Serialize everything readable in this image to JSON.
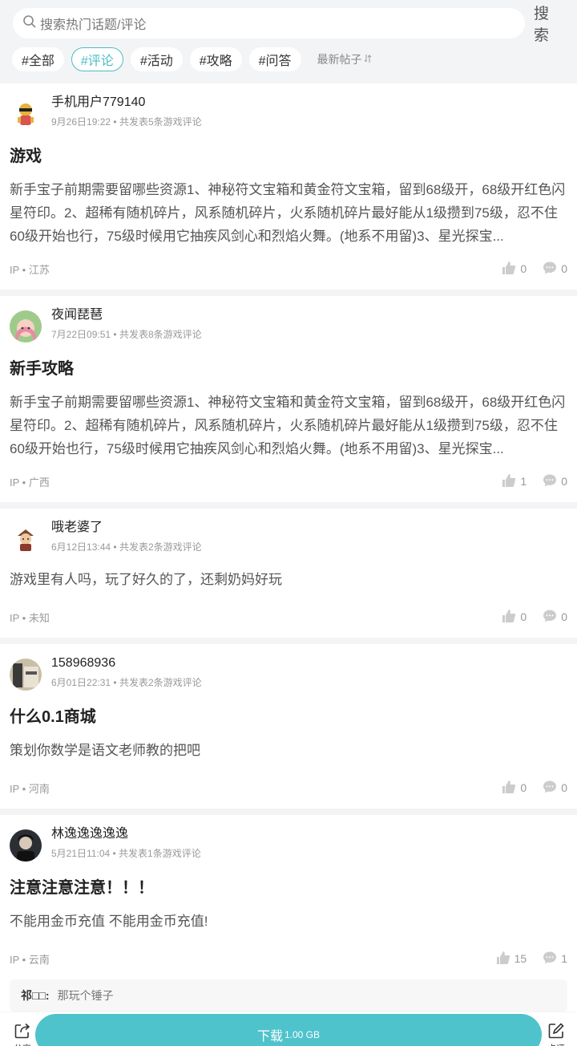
{
  "search": {
    "placeholder": "搜索热门话题/评论",
    "button": "搜索"
  },
  "tags": [
    "#全部",
    "#评论",
    "#活动",
    "#攻略",
    "#问答"
  ],
  "active_tag": "#评论",
  "sort_label": "最新帖子",
  "posts": [
    {
      "user": "手机用户779140",
      "date": "9月26日19:22",
      "meta": "共发表5条游戏评论",
      "title": "游戏",
      "body": "新手宝子前期需要留哪些资源1、神秘符文宝箱和黄金符文宝箱，留到68级开，68级开红色闪星符印。2、超稀有随机碎片，风系随机碎片，火系随机碎片最好能从1级攒到75级，忍不住60级开始也行，75级时候用它抽疾风剑心和烈焰火舞。(地系不用留)3、星光探宝...",
      "ip": "IP • 江苏",
      "likes": "0",
      "comments": "0"
    },
    {
      "user": "夜闻琵琶",
      "date": "7月22日09:51",
      "meta": "共发表8条游戏评论",
      "title": "新手攻略",
      "body": "新手宝子前期需要留哪些资源1、神秘符文宝箱和黄金符文宝箱，留到68级开，68级开红色闪星符印。2、超稀有随机碎片，风系随机碎片，火系随机碎片最好能从1级攒到75级，忍不住60级开始也行，75级时候用它抽疾风剑心和烈焰火舞。(地系不用留)3、星光探宝...",
      "ip": "IP • 广西",
      "likes": "1",
      "comments": "0"
    },
    {
      "user": "哦老婆了",
      "date": "6月12日13:44",
      "meta": "共发表2条游戏评论",
      "title": "",
      "body": "游戏里有人吗，玩了好久的了，还剩奶妈好玩",
      "ip": "IP • 未知",
      "likes": "0",
      "comments": "0"
    },
    {
      "user": "158968936",
      "date": "6月01日22:31",
      "meta": "共发表2条游戏评论",
      "title": "什么0.1商城",
      "body": "策划你数学是语文老师教的把吧",
      "ip": "IP • 河南",
      "likes": "0",
      "comments": "0"
    },
    {
      "user": "林逸逸逸逸逸",
      "date": "5月21日11:04",
      "meta": "共发表1条游戏评论",
      "title": "注意注意注意！！！",
      "body": "不能用金币充值 不能用金币充值!",
      "ip": "IP • 云南",
      "likes": "15",
      "comments": "1",
      "reply": {
        "name": "祁□□:",
        "text": "那玩个锤子"
      }
    }
  ],
  "bottom": {
    "share": "分享",
    "download": "下载",
    "size": "1.00 GB",
    "comment": "点评"
  },
  "colors": {
    "accent": "#4fc3cc",
    "tag_active": "#4bbdc7"
  }
}
